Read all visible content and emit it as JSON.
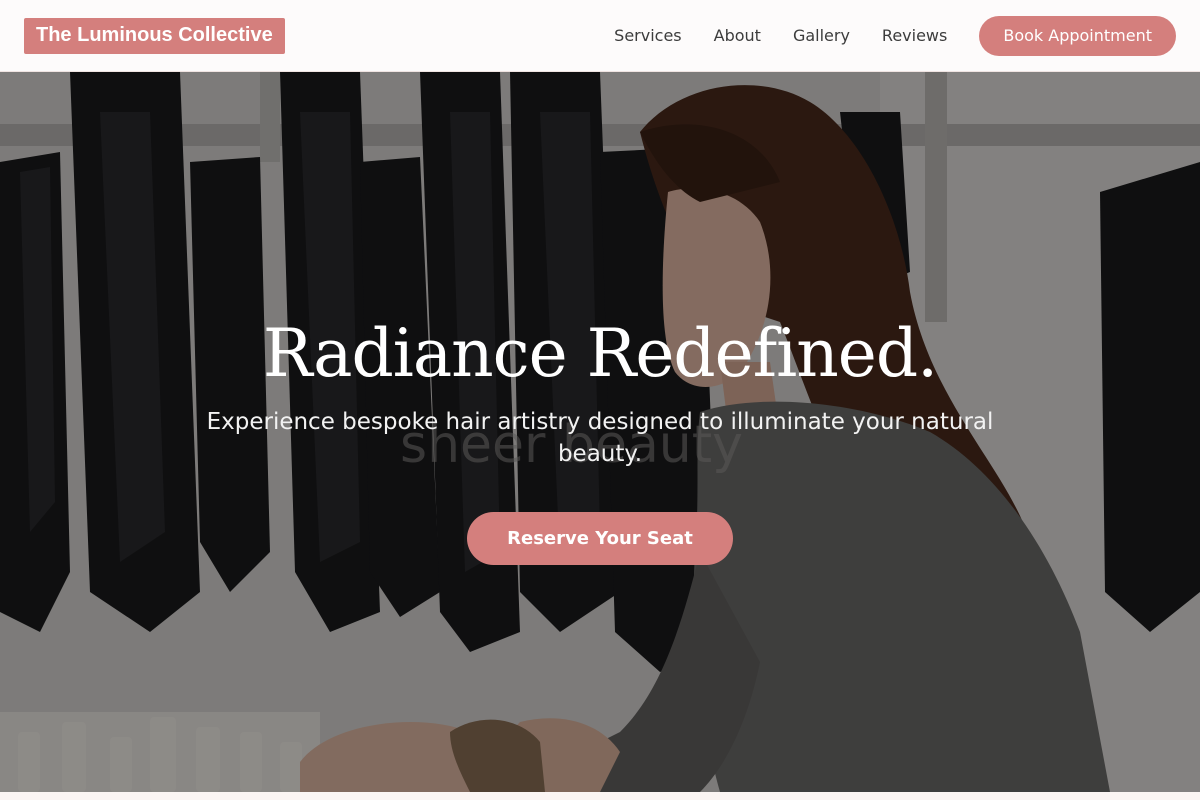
{
  "brand": {
    "name": "The Luminous Collective",
    "accent": "#d47f7d"
  },
  "nav": {
    "links": [
      "Services",
      "About",
      "Gallery",
      "Reviews"
    ],
    "cta": "Book Appointment"
  },
  "hero": {
    "title": "Radiance Redefined.",
    "subtitle": "Experience bespoke hair artistry designed to illuminate your natural beauty.",
    "cta": "Reserve Your Seat",
    "image": "salon-stylist-washing-client-hair"
  }
}
